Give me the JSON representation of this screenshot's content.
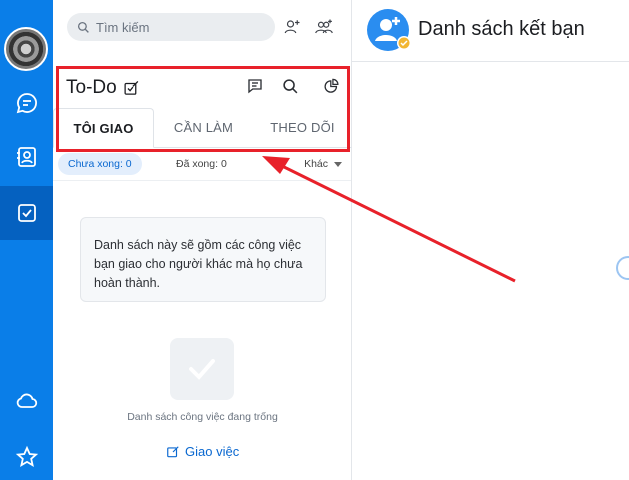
{
  "search": {
    "placeholder": "Tìm kiếm"
  },
  "todo": {
    "title": "To-Do",
    "tabs": [
      {
        "label": "TÔI GIAO",
        "active": true
      },
      {
        "label": "CẦN LÀM",
        "active": false
      },
      {
        "label": "THEO DÕI",
        "active": false
      }
    ],
    "filters": {
      "pending": "Chưa xong: 0",
      "done": "Đã xong: 0",
      "other": "Khác"
    },
    "info": "Danh sách này sẽ gồm các công việc bạn giao cho người khác mà họ chưa hoàn thành.",
    "empty_text": "Danh sách công việc đang trống",
    "assign_label": "Giao việc"
  },
  "right": {
    "title": "Danh sách kết bạn"
  },
  "colors": {
    "rail": "#0a7ee8",
    "rail_active": "#0561c0",
    "accent": "#0a68d0",
    "highlight_box": "#e8212a"
  },
  "icons": {
    "rail": [
      "avatar",
      "chat-icon",
      "contacts-icon",
      "todo-check-icon",
      "cloud-icon",
      "star-icon"
    ],
    "search": "search-icon",
    "add_friend": "add-friend-icon",
    "create_group": "create-group-icon",
    "header": [
      "edit-note-icon",
      "message-icon",
      "search-icon",
      "pie-chart-icon"
    ]
  }
}
